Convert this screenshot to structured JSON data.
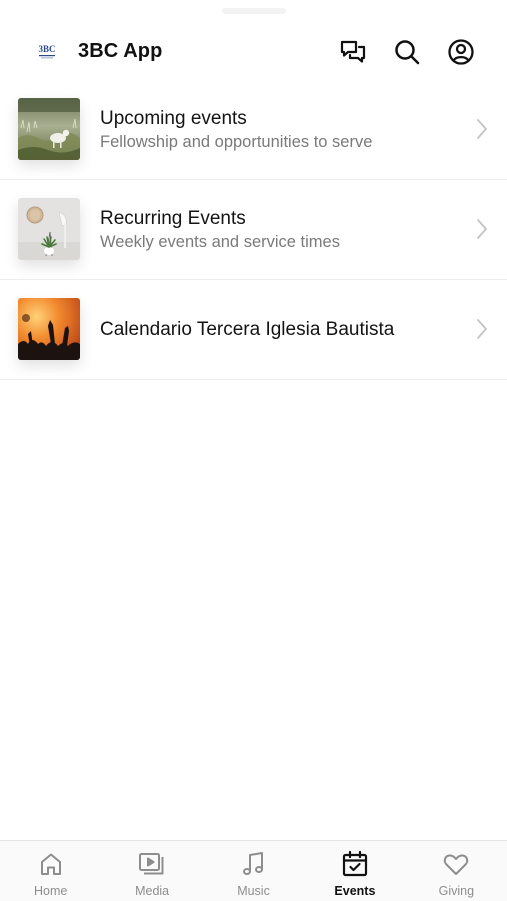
{
  "header": {
    "app_title": "3BC App",
    "logo_text": "3BC",
    "icons": [
      "chat-icon",
      "search-icon",
      "profile-icon"
    ]
  },
  "list": {
    "items": [
      {
        "title": "Upcoming events",
        "subtitle": "Fellowship and opportunities to serve",
        "thumbnail": "goat-in-field-photo"
      },
      {
        "title": "Recurring Events",
        "subtitle": "Weekly events and service times",
        "thumbnail": "plant-and-clock-photo"
      },
      {
        "title": "Calendario Tercera Iglesia Bautista",
        "subtitle": "",
        "thumbnail": "worship-crowd-photo"
      }
    ]
  },
  "tabbar": {
    "active": "Events",
    "tabs": [
      {
        "label": "Home",
        "icon": "home-icon"
      },
      {
        "label": "Media",
        "icon": "media-icon"
      },
      {
        "label": "Music",
        "icon": "music-icon"
      },
      {
        "label": "Events",
        "icon": "calendar-icon"
      },
      {
        "label": "Giving",
        "icon": "heart-icon"
      }
    ]
  },
  "colors": {
    "active_tab": "#111111",
    "inactive_tab": "#8d8d8d",
    "subtitle": "#7a7a7a",
    "divider": "#ececec"
  }
}
